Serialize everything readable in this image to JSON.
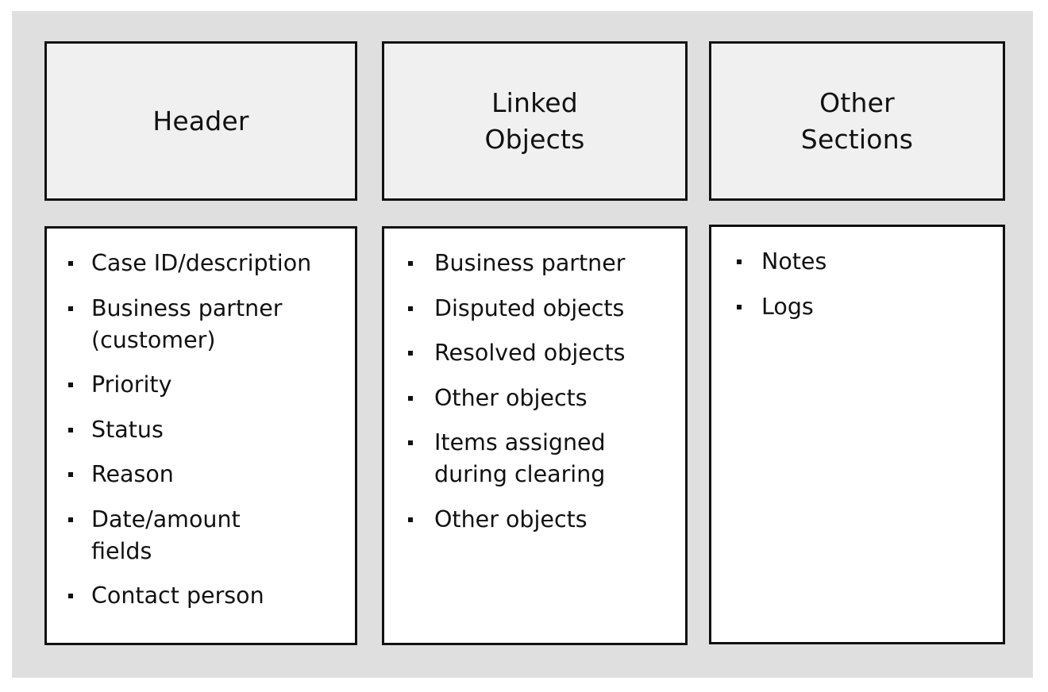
{
  "diagram": {
    "columns": [
      {
        "title_lines": [
          "Header"
        ],
        "items": [
          {
            "lines": [
              "Case ID/description"
            ]
          },
          {
            "lines": [
              "Business partner",
              "(customer)"
            ]
          },
          {
            "lines": [
              "Priority"
            ]
          },
          {
            "lines": [
              "Status"
            ]
          },
          {
            "lines": [
              "Reason"
            ]
          },
          {
            "lines": [
              "Date/amount",
              "fields"
            ]
          },
          {
            "lines": [
              "Contact person"
            ]
          }
        ]
      },
      {
        "title_lines": [
          "Linked",
          "Objects"
        ],
        "items": [
          {
            "lines": [
              "Business partner"
            ]
          },
          {
            "lines": [
              "Disputed objects"
            ]
          },
          {
            "lines": [
              "Resolved objects"
            ]
          },
          {
            "lines": [
              "Other objects"
            ]
          },
          {
            "lines": [
              "Items assigned",
              "during clearing"
            ]
          },
          {
            "lines": [
              "Other objects"
            ]
          }
        ]
      },
      {
        "title_lines": [
          "Other",
          "Sections"
        ],
        "items": [
          {
            "lines": [
              "Notes"
            ]
          },
          {
            "lines": [
              "Logs"
            ]
          }
        ]
      }
    ],
    "colors": {
      "panel_background": "#dfdfdf",
      "header_box_fill": "#f0f0f0",
      "body_box_fill": "#ffffff",
      "border": "#111111",
      "text": "#111111"
    }
  }
}
